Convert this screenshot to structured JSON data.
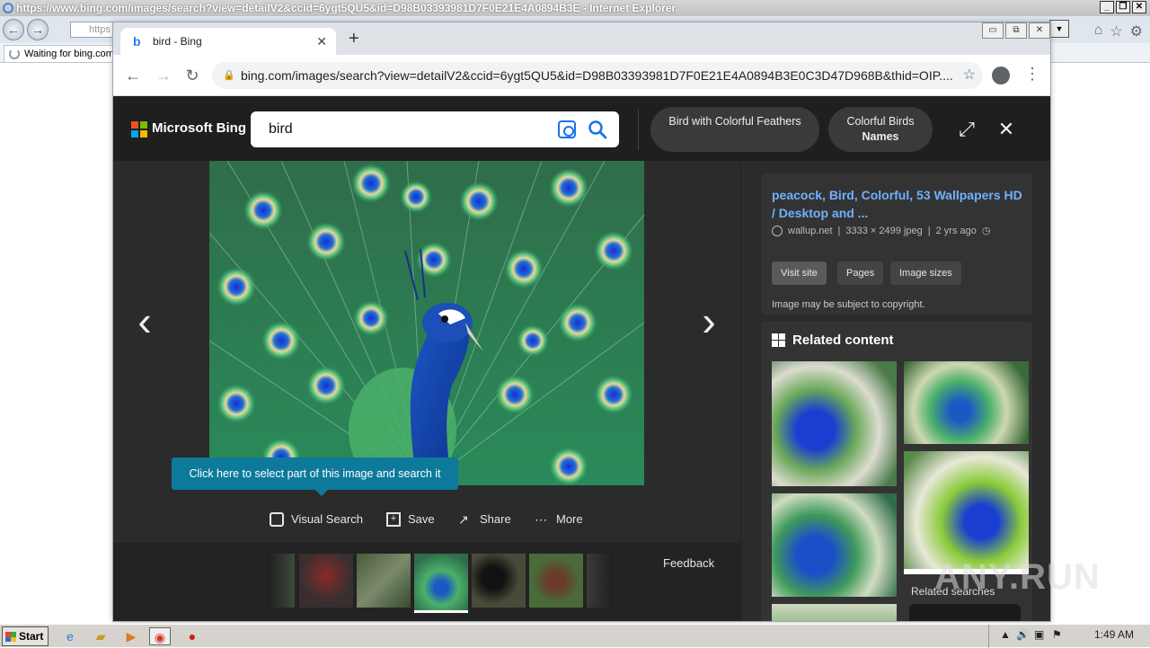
{
  "ie": {
    "title": "https://www.bing.com/images/search?view=detailV2&ccid=6ygt5QU5&id=D98B03393981D7F0E21E4A0894B3E - Internet Explorer",
    "address_partial": "https",
    "tab_label": "Waiting for bing.com"
  },
  "chrome": {
    "tab_title": "bird - Bing",
    "new_tab": "+",
    "url": "bing.com/images/search?view=detailV2&ccid=6ygt5QU5&id=D98B03393981D7F0E21E4A0894B3E0C3D47D968B&thid=OIP...."
  },
  "bing": {
    "logo_text": "Microsoft Bing",
    "search_value": "bird",
    "related_pills": [
      {
        "line1": "Bird with Colorful Feathers",
        "line2": ""
      },
      {
        "line1": "Colorful Birds",
        "line2": "Names"
      }
    ],
    "tooltip": "Click here to select part of this image and search it",
    "actions": {
      "visual_search": "Visual Search",
      "save": "Save",
      "share": "Share",
      "more": "More"
    },
    "feedback": "Feedback",
    "info": {
      "title": "peacock, Bird, Colorful, 53 Wallpapers HD / Desktop and ...",
      "source": "wallup.net",
      "dimensions": "3333 × 2499 jpeg",
      "age": "2 yrs ago",
      "buttons": [
        "Visit site",
        "Pages",
        "Image sizes"
      ],
      "copyright": "Image may be subject to copyright."
    },
    "related_content_title": "Related content",
    "related_searches_title": "Related searches"
  },
  "watermark": "ANY.RUN",
  "taskbar": {
    "start_label": "Start",
    "clock": "1:49 AM"
  },
  "colors": {
    "bing_dark": "#2b2b2b",
    "bing_header": "#1f1f1f",
    "link_blue": "#6fb1ff",
    "tooltip_teal": "#0e7a9b"
  }
}
